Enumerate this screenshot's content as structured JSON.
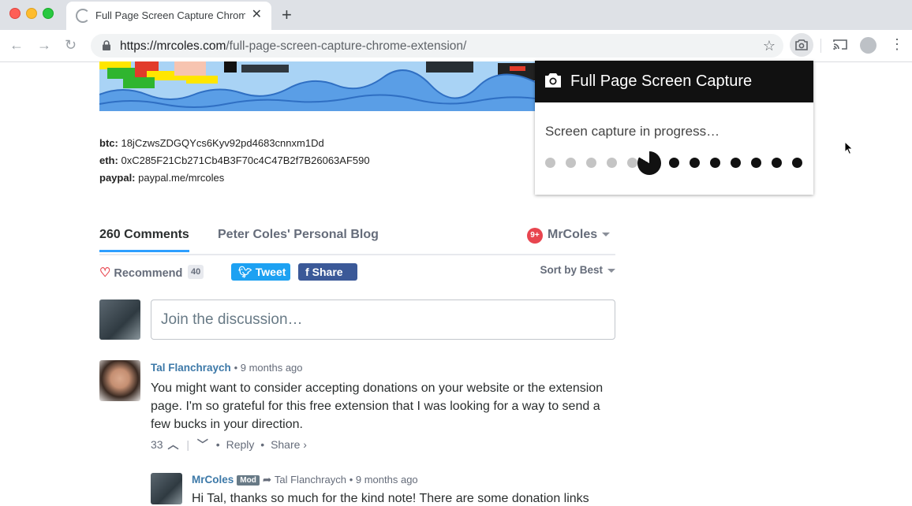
{
  "browser": {
    "tab_title": "Full Page Screen Capture Chrome Extension",
    "tab_close": "✕",
    "new_tab": "+",
    "url_domain": "https://mrcoles.com",
    "url_path": "/full-page-screen-capture-chrome-extension/"
  },
  "donations": {
    "btc_label": "btc:",
    "btc_value": "18jCzwsZDGQYcs6Kyv92pd4683cnnxm1Dd",
    "eth_label": "eth:",
    "eth_value": "0xC285F21Cb271Cb4B3F70c4C47B2f7B26063AF590",
    "paypal_label": "paypal:",
    "paypal_value": "paypal.me/mrcoles"
  },
  "disqus": {
    "comments_tab": "260 Comments",
    "blog_tab": "Peter Coles' Personal Blog",
    "notifications": "9+",
    "user": "MrColes",
    "recommend_label": "Recommend",
    "recommend_count": "40",
    "tweet_label": "Tweet",
    "share_label": "Share",
    "sort_label": "Sort by Best",
    "compose_placeholder": "Join the discussion…"
  },
  "comments": [
    {
      "author": "Tal Flanchraych",
      "time": "9 months ago",
      "text": "You might want to consider accepting donations on your website or the extension page. I'm so grateful for this free extension that I was looking for a way to send a few bucks in your direction.",
      "votes": "33",
      "reply_label": "Reply",
      "share_label": "Share ›"
    },
    {
      "author": "MrColes",
      "badge": "Mod",
      "reply_to": "Tal Flanchraych",
      "time": "9 months ago",
      "text": "Hi Tal, thanks so much for the kind note! There are some donation links"
    }
  ],
  "popup": {
    "title": "Full Page Screen Capture",
    "status": "Screen capture in progress…",
    "progress_done": 5,
    "progress_total": 13
  },
  "colors": {
    "tweet": "#1da1f2",
    "facebook": "#3b5998",
    "link": "#3d79a8",
    "popup_header": "#111111"
  }
}
